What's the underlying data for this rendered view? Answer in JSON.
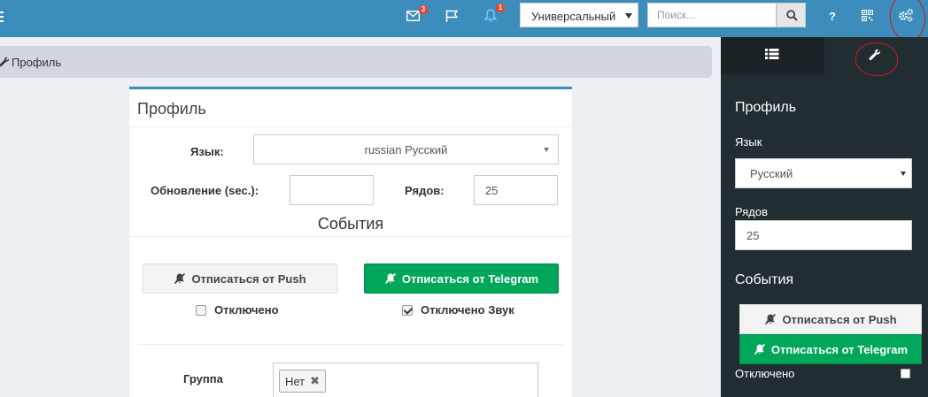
{
  "topbar": {
    "messages_badge": "3",
    "notifications_badge": "1",
    "theme_select": "Универсальный",
    "search_placeholder": "Поиск...",
    "help_label": "?",
    "icons": [
      "menu-icon",
      "envelope-icon",
      "flag-icon",
      "bell-icon",
      "search-icon",
      "qrcode-icon",
      "gears-icon"
    ]
  },
  "breadcrumb": {
    "label": "Профиль"
  },
  "profile": {
    "title": "Профиль",
    "language_label": "Язык:",
    "language_value": "russian Русский",
    "refresh_label": "Обновление (sec.):",
    "refresh_value": "",
    "rows_label": "Рядов:",
    "rows_value": "25",
    "events_title": "События",
    "unsubscribe_push": "Отписаться от Push",
    "unsubscribe_telegram": "Отписаться от Telegram",
    "disabled_label": "Отключено",
    "disabled_sound_label": "Отключено Звук",
    "disabled_checked": false,
    "disabled_sound_checked": true,
    "group_label": "Группа",
    "group_tag": "Нет"
  },
  "sidebar": {
    "title": "Профиль",
    "language_label": "Язык",
    "language_value": "Русский",
    "rows_label": "Рядов",
    "rows_value": "25",
    "events_title": "События",
    "unsubscribe_push": "Отписаться от Push",
    "unsubscribe_telegram": "Отписаться от Telegram",
    "disabled_label": "Отключено"
  },
  "colors": {
    "navbar": "#3c8dbc",
    "sidebar": "#222d32",
    "success": "#00a65a",
    "annotation": "#d7141a"
  }
}
